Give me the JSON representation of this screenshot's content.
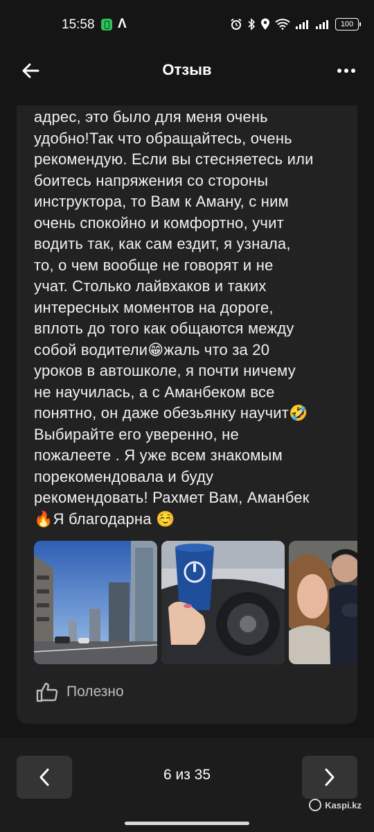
{
  "status_bar": {
    "time": "15:58",
    "battery": "100"
  },
  "header": {
    "title": "Отзыв"
  },
  "review": {
    "lines": [
      "адрес, это было для меня очень",
      "удобно!Так что обращайтесь, очень",
      "рекомендую. Если вы стесняетесь или",
      "боитесь напряжения со стороны",
      "инструктора, то Вам к Аману, с ним",
      "очень спокойно и комфортно, учит",
      "водить так, как сам ездит, я узнала,",
      "то, о чем вообще не говорят и не",
      "учат. Столько лайвхаков и таких",
      "интересных моментов на дороге,",
      "вплоть до того как общаются между",
      "собой водители😁жаль что за 20",
      "уроков в автошколе, я почти ничему",
      "не научилась, а с Аманбеком все",
      "понятно, он даже обезьянку научит🤣",
      "Выбирайте его уверенно, не",
      "пожалеете . Я уже всем знакомым",
      "порекомендовала и буду",
      "рекомендовать! Рахмет Вам, Аманбек",
      "🔥Я благодарна ☺️"
    ],
    "helpful_label": "Полезно"
  },
  "pagination": {
    "counter": "6 из 35"
  },
  "watermark": {
    "text": "Kaspi.kz"
  },
  "colors": {
    "background": "#151515",
    "card": "#222222",
    "nav_button": "#343434"
  }
}
